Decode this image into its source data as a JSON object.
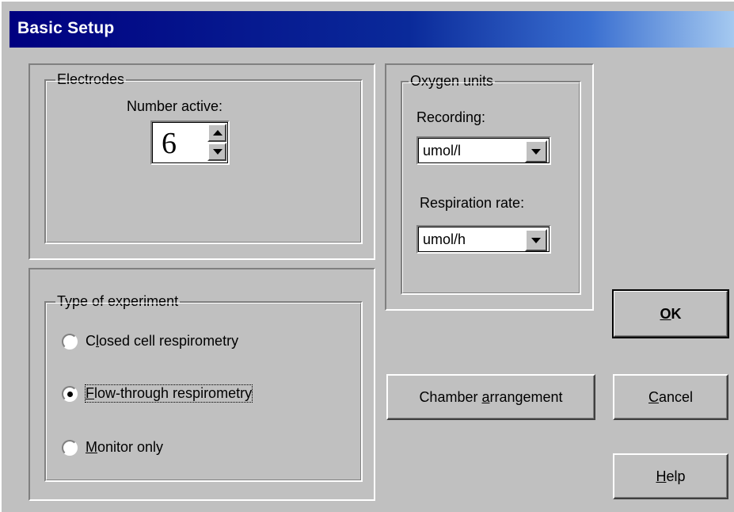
{
  "window": {
    "title": "Basic Setup"
  },
  "electrodes": {
    "group_label": "Electrodes",
    "number_label": "Number active:",
    "number_value": "6"
  },
  "oxygen_units": {
    "group_label": "Oxygen units",
    "recording_label": "Recording:",
    "recording_value": "umol/l",
    "respiration_label": "Respiration rate:",
    "respiration_value": "umol/h"
  },
  "experiment": {
    "group_label": "Type of experiment",
    "options": [
      {
        "pre": "C",
        "key": "l",
        "post": "osed cell respirometry",
        "selected": false
      },
      {
        "pre": "",
        "key": "F",
        "post": "low-through respirometry",
        "selected": true
      },
      {
        "pre": "",
        "key": "M",
        "post": "onitor only",
        "selected": false
      }
    ]
  },
  "buttons": {
    "ok": {
      "pre": "",
      "key": "O",
      "post": "K"
    },
    "cancel": {
      "pre": "",
      "key": "C",
      "post": "ancel"
    },
    "help": {
      "pre": "",
      "key": "H",
      "post": "elp"
    },
    "chamber": {
      "pre": "Chamber ",
      "key": "a",
      "post": "rrangement"
    }
  }
}
